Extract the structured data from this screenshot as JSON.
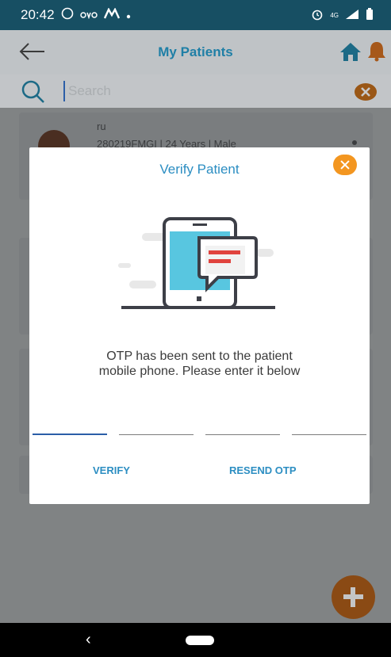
{
  "status_bar": {
    "time": "20:42",
    "carrier_icons": [
      "whatsapp-icon",
      "ovo-icon",
      "mail-icon",
      "dot"
    ],
    "right_text": "4G"
  },
  "app_bar": {
    "title": "My Patients"
  },
  "search": {
    "placeholder": "Search"
  },
  "patient_list": [
    {
      "name": "ru",
      "meta": "280219FMGI | 24 Years | Male"
    }
  ],
  "dialog": {
    "title": "Verify Patient",
    "message_line1": "OTP has been sent to the patient",
    "message_line2": "mobile phone. Please enter it below",
    "otp_fields": [
      "",
      "",
      "",
      ""
    ],
    "verify_label": "VERIFY",
    "resend_label": "RESEND OTP"
  },
  "colors": {
    "status_bar": "#174f63",
    "accent_blue": "#2c8ec2",
    "accent_orange": "#f39620",
    "overlay_text": "#1f7fa6"
  }
}
